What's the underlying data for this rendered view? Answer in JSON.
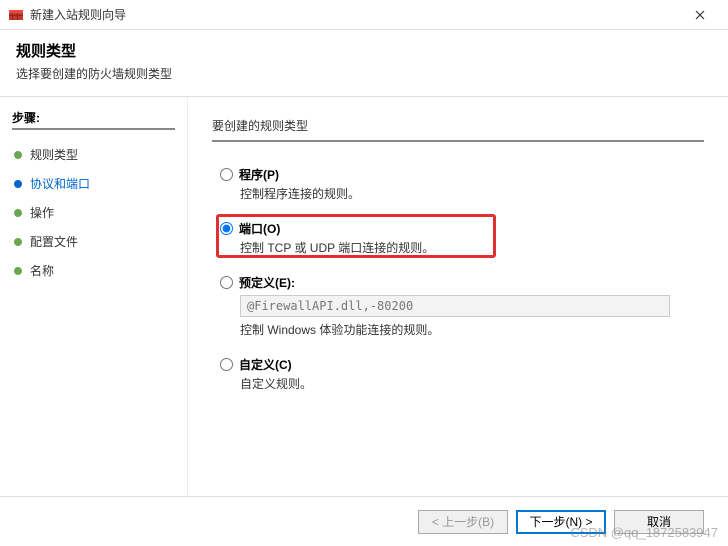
{
  "window": {
    "title": "新建入站规则向导"
  },
  "header": {
    "title": "规则类型",
    "subtitle": "选择要创建的防火墙规则类型"
  },
  "sidebar": {
    "steps_label": "步骤:",
    "items": [
      {
        "label": "规则类型"
      },
      {
        "label": "协议和端口"
      },
      {
        "label": "操作"
      },
      {
        "label": "配置文件"
      },
      {
        "label": "名称"
      }
    ],
    "active_index": 1
  },
  "main": {
    "section_title": "要创建的规则类型",
    "options": [
      {
        "label": "程序(P)",
        "desc": "控制程序连接的规则。"
      },
      {
        "label": "端口(O)",
        "desc": "控制 TCP 或 UDP 端口连接的规则。"
      },
      {
        "label": "预定义(E):",
        "desc": "控制 Windows 体验功能连接的规则。",
        "select_value": "@FirewallAPI.dll,-80200"
      },
      {
        "label": "自定义(C)",
        "desc": "自定义规则。"
      }
    ],
    "selected_index": 1
  },
  "footer": {
    "back": "< 上一步(B)",
    "next": "下一步(N) >",
    "cancel": "取消"
  },
  "watermark": "CSDN @qq_1872583947"
}
